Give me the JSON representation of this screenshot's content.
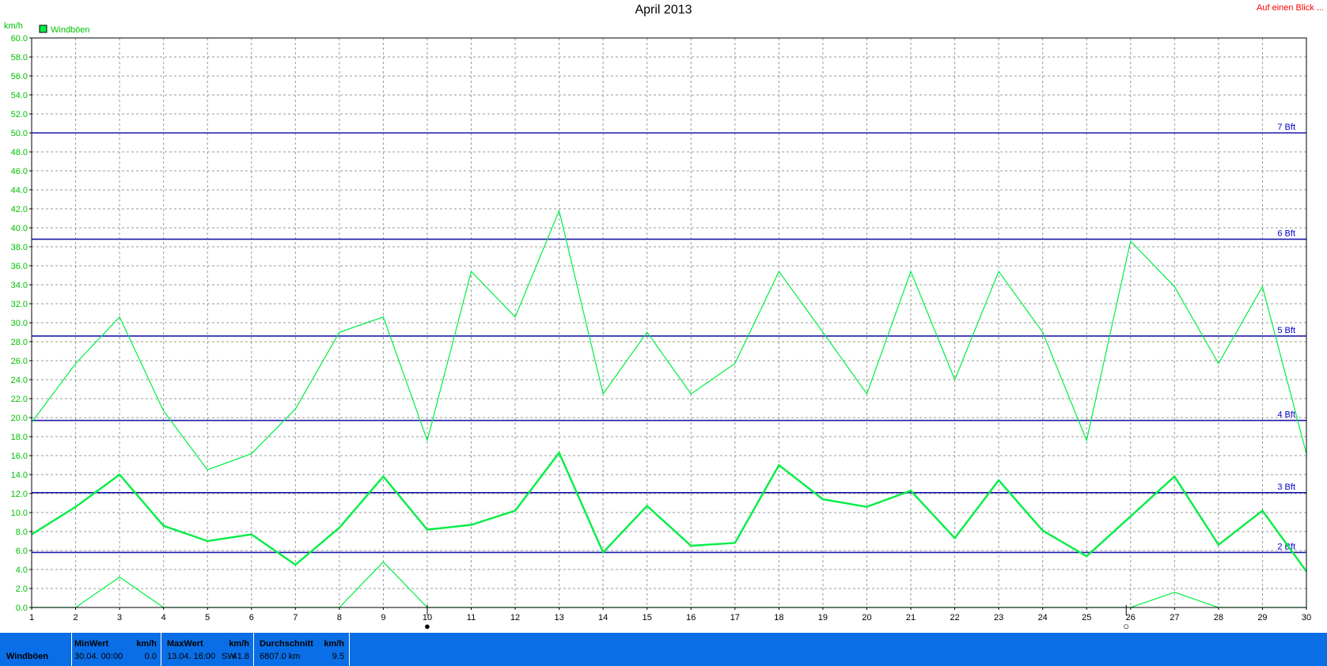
{
  "title": "April 2013",
  "quick_link": "Auf einen Blick ...",
  "colors": {
    "series": "#00ee44",
    "bft": "#1a1aaa",
    "footer": "#0a6ee6"
  },
  "chart_data": {
    "type": "line",
    "ylabel": "km/h",
    "ylim": [
      0,
      60
    ],
    "ytick_step": 2,
    "xlim": [
      1,
      30
    ],
    "grid": true,
    "legend": {
      "label": "Windböen",
      "placement": "top-left"
    },
    "x": [
      1,
      2,
      3,
      4,
      5,
      6,
      7,
      8,
      9,
      10,
      11,
      12,
      13,
      14,
      15,
      16,
      17,
      18,
      19,
      20,
      21,
      22,
      23,
      24,
      25,
      26,
      27,
      28,
      29,
      30
    ],
    "series": [
      {
        "name": "Windböen",
        "role": "daily max",
        "values": [
          19.5,
          25.7,
          30.6,
          20.7,
          14.5,
          16.2,
          20.9,
          29.0,
          30.6,
          17.6,
          35.4,
          30.6,
          41.8,
          22.5,
          29.0,
          22.5,
          25.7,
          35.4,
          29.0,
          22.5,
          35.4,
          24.0,
          35.4,
          29.0,
          17.6,
          38.6,
          33.8,
          25.7,
          33.8,
          16.2
        ]
      },
      {
        "role": "daily average",
        "values": [
          7.7,
          10.6,
          14.0,
          8.6,
          7.0,
          7.7,
          4.5,
          8.4,
          13.8,
          8.2,
          8.7,
          10.2,
          16.3,
          5.8,
          10.7,
          6.5,
          6.8,
          15.0,
          11.4,
          10.6,
          12.3,
          7.3,
          13.4,
          8.1,
          5.4,
          9.6,
          13.8,
          6.6,
          10.2,
          3.8
        ]
      },
      {
        "role": "daily min",
        "values": [
          0,
          0,
          3.2,
          0,
          0,
          0,
          0,
          0,
          4.8,
          0,
          0,
          0,
          0,
          0,
          0,
          0,
          0,
          0,
          0,
          0,
          0,
          0,
          0,
          0,
          0,
          0,
          1.6,
          0,
          0,
          0
        ]
      }
    ],
    "reference_lines": [
      {
        "label": "2 Bft",
        "value": 5.8
      },
      {
        "label": "3 Bft",
        "value": 12.1
      },
      {
        "label": "4 Bft",
        "value": 19.7
      },
      {
        "label": "5 Bft",
        "value": 28.6
      },
      {
        "label": "6 Bft",
        "value": 38.8
      },
      {
        "label": "7 Bft",
        "value": 50.0
      }
    ],
    "moon_phases": [
      {
        "day": 10,
        "symbol": "●"
      },
      {
        "day": 25.9,
        "symbol": "○"
      }
    ]
  },
  "footer": {
    "row_label": "Windböen",
    "min": {
      "header": "MinWert",
      "unit": "km/h",
      "when": "30.04.  00:00",
      "value": "0.0"
    },
    "max": {
      "header": "MaxWert",
      "unit": "km/h",
      "when": "13.04.  16:00",
      "dir": "SW",
      "value": "41.8"
    },
    "avg": {
      "header": "Durchschnitt",
      "unit": "km/h",
      "total": "6807.0 km",
      "value": "9.5"
    }
  }
}
